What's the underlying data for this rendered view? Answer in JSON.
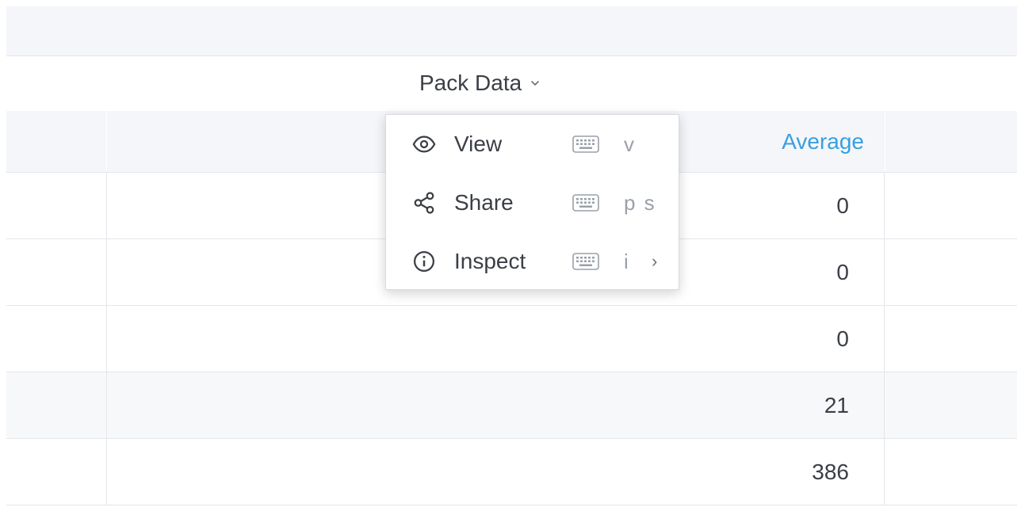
{
  "panel": {
    "title": "Pack Data"
  },
  "table": {
    "header_average": "Average",
    "rows": [
      "0",
      "0",
      "0",
      "21",
      "386"
    ]
  },
  "menu": {
    "items": [
      {
        "label": "View",
        "icon": "eye-icon",
        "shortcut": "v"
      },
      {
        "label": "Share",
        "icon": "share-icon",
        "shortcut": "p s"
      },
      {
        "label": "Inspect",
        "icon": "info-icon",
        "shortcut": "i",
        "submenu_indicator": "›"
      }
    ]
  },
  "colors": {
    "accent": "#3a9fe0",
    "text": "#3b3f45",
    "muted": "#9aa0a8",
    "header_bg": "#f4f6f9"
  }
}
